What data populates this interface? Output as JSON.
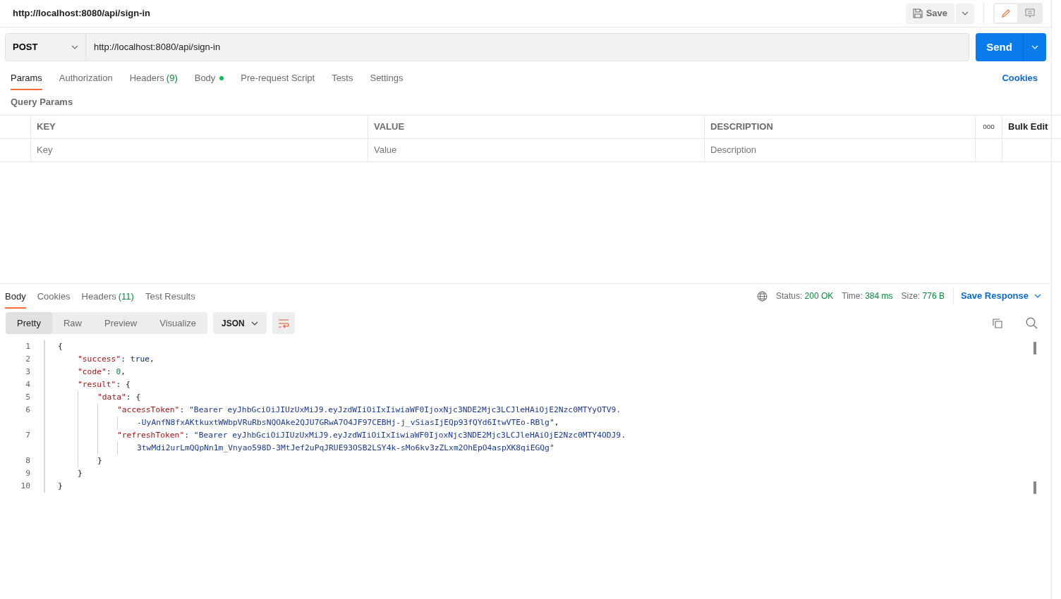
{
  "request_title": "http://localhost:8080/api/sign-in",
  "save_button": {
    "label": "Save"
  },
  "mode_toggle": [
    {
      "kind": "edit",
      "selected": true
    },
    {
      "kind": "comments",
      "selected": false
    }
  ],
  "method": "POST",
  "url": "http://localhost:8080/api/sign-in",
  "send_button": {
    "label": "Send"
  },
  "request_tabs": [
    {
      "label": "Params",
      "selected": true
    },
    {
      "label": "Authorization",
      "selected": false
    },
    {
      "label": "Headers",
      "count": "(9)",
      "selected": false
    },
    {
      "label": "Body",
      "dot": true,
      "selected": false
    },
    {
      "label": "Pre-request Script",
      "selected": false
    },
    {
      "label": "Tests",
      "selected": false
    },
    {
      "label": "Settings",
      "selected": false
    }
  ],
  "cookies_link": "Cookies",
  "query_params": {
    "title": "Query Params",
    "columns": [
      "KEY",
      "VALUE",
      "DESCRIPTION"
    ],
    "more": "ooo",
    "bulk_edit": "Bulk Edit",
    "placeholders": [
      "Key",
      "Value",
      "Description"
    ]
  },
  "response_tabs": [
    {
      "label": "Body",
      "selected": true
    },
    {
      "label": "Cookies",
      "selected": false
    },
    {
      "label": "Headers",
      "count": "(11)",
      "selected": false
    },
    {
      "label": "Test Results",
      "selected": false
    }
  ],
  "response_meta": [
    {
      "label": "Status:",
      "value": "200 OK"
    },
    {
      "label": "Time:",
      "value": "384 ms"
    },
    {
      "label": "Size:",
      "value": "776 B"
    }
  ],
  "save_response": "Save Response",
  "view_modes": [
    {
      "label": "Pretty",
      "selected": true
    },
    {
      "label": "Raw",
      "selected": false
    },
    {
      "label": "Preview",
      "selected": false
    },
    {
      "label": "Visualize",
      "selected": false
    }
  ],
  "format": "JSON",
  "code_rows": [
    {
      "number": "1",
      "tokens": [
        {
          "kind": "open",
          "text": "{"
        }
      ]
    },
    {
      "number": "2",
      "tokens": [
        {
          "kind": "key",
          "text": "\"success\""
        },
        {
          "kind": "punct",
          "text": ": "
        },
        {
          "kind": "bool",
          "text": "true"
        },
        {
          "kind": "punct",
          "text": ","
        }
      ]
    },
    {
      "number": "3",
      "tokens": [
        {
          "kind": "key",
          "text": "\"code\""
        },
        {
          "kind": "punct",
          "text": ": "
        },
        {
          "kind": "num",
          "text": "0"
        },
        {
          "kind": "punct",
          "text": ","
        }
      ]
    },
    {
      "number": "4",
      "tokens": [
        {
          "kind": "key",
          "text": "\"result\""
        },
        {
          "kind": "punct",
          "text": ": "
        },
        {
          "kind": "open",
          "text": "{"
        }
      ]
    },
    {
      "number": "5",
      "tokens": [
        {
          "kind": "key",
          "text": "\"data\""
        },
        {
          "kind": "punct",
          "text": ": "
        },
        {
          "kind": "open",
          "text": "{"
        }
      ]
    },
    {
      "number": "6",
      "tokens": [
        {
          "kind": "key",
          "text": "\"accessToken\""
        },
        {
          "kind": "punct",
          "text": ": "
        },
        {
          "kind": "str",
          "text": "\"Bearer eyJhbGciOiJIUzUxMiJ9.eyJzdWIiOiIxIiwiaWF0IjoxNjc3NDE2Mjc3LCJleHAiOjE2Nzc0MTYyOTV9."
        }
      ]
    },
    {
      "continuation": true,
      "tokens": [
        {
          "kind": "str",
          "text": "-UyAnfN8fxAKtkuxtWWbpVRuRbsNQOAke2QJU7GRwA7O4JF97CEBHj-j_vSiasIjEQp93fQYd6ItwVTEo-RBlg\""
        },
        {
          "kind": "punct",
          "text": ","
        }
      ]
    },
    {
      "number": "7",
      "tokens": [
        {
          "kind": "key",
          "text": "\"refreshToken\""
        },
        {
          "kind": "punct",
          "text": ": "
        },
        {
          "kind": "str",
          "text": "\"Bearer eyJhbGciOiJIUzUxMiJ9.eyJzdWIiOiIxIiwiaWF0IjoxNjc3NDE2Mjc3LCJleHAiOjE2Nzc0MTY4ODJ9."
        }
      ]
    },
    {
      "continuation": true,
      "tokens": [
        {
          "kind": "str",
          "text": "3twMdi2urLmQQpNn1m_Vnyao598D-3MtJef2uPqJRUE93OSB2LSY4k-sMo6kv3zZLxm2OhEpO4aspXK8qiEGQg\""
        }
      ]
    },
    {
      "number": "8",
      "tokens": [
        {
          "kind": "close",
          "text": "}"
        }
      ]
    },
    {
      "number": "9",
      "tokens": [
        {
          "kind": "close",
          "text": "}"
        }
      ]
    },
    {
      "number": "10",
      "tokens": [
        {
          "kind": "close",
          "text": "}"
        }
      ]
    }
  ]
}
